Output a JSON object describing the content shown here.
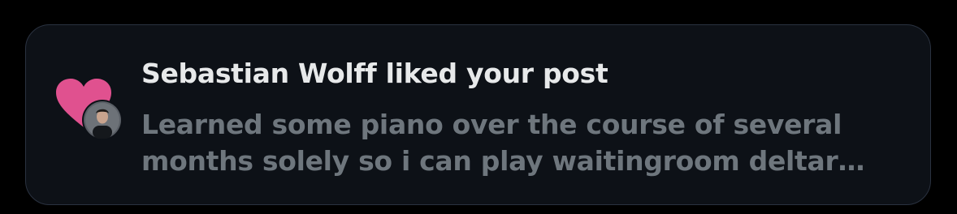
{
  "notification": {
    "title": "Sebastian Wolff liked your post",
    "preview_lines": [
      "Learned some piano over the course of several",
      "months solely so i can play waitingroom deltar…"
    ],
    "icons": {
      "like": "heart-icon",
      "user": "avatar"
    },
    "colors": {
      "background": "#000000",
      "card": "#0d1117",
      "card_border": "#2a3240",
      "heart": "#e0518f",
      "title_text": "#e7e9ea",
      "preview_text": "#6e767d"
    }
  }
}
